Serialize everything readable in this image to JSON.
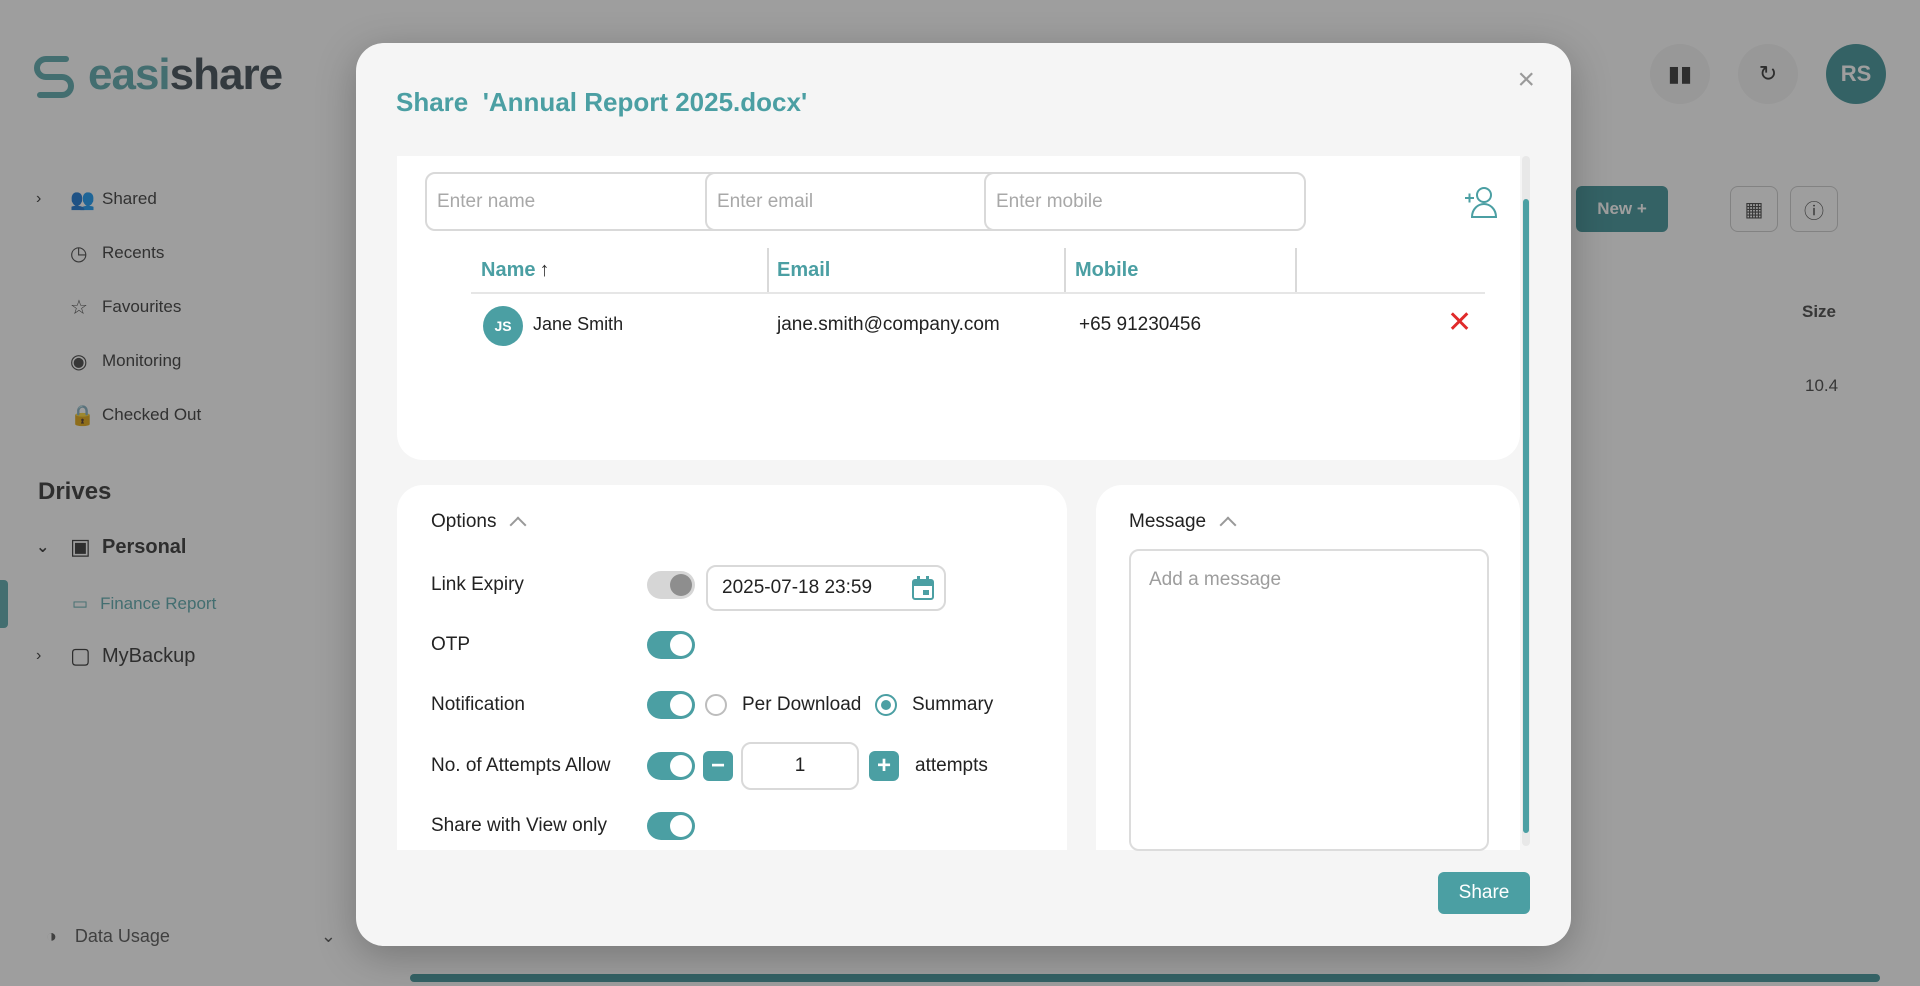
{
  "app": {
    "logo_prefix": "easi",
    "logo_suffix": "share",
    "avatar_initials": "RS",
    "sidebar": {
      "items": [
        {
          "label": "Shared",
          "icon": "people-icon"
        },
        {
          "label": "Recents",
          "icon": "clock-icon"
        },
        {
          "label": "Favourites",
          "icon": "star-icon"
        },
        {
          "label": "Monitoring",
          "icon": "monitor-icon"
        },
        {
          "label": "Checked Out",
          "icon": "lock-icon"
        }
      ],
      "drives_heading": "Drives",
      "personal": "Personal",
      "finance_report": "Finance Report",
      "mybackup": "MyBackup",
      "data_usage": "Data Usage"
    },
    "toolbar": {
      "new_label": "New +"
    },
    "table": {
      "size_header": "Size",
      "size_value": "10.4"
    }
  },
  "modal": {
    "title": "Share  'Annual Report 2025.docx'",
    "recipients": {
      "name_placeholder": "Enter name",
      "email_placeholder": "Enter email",
      "mobile_placeholder": "Enter mobile",
      "columns": {
        "name": "Name",
        "email": "Email",
        "mobile": "Mobile"
      },
      "sort_indicator": "↑",
      "rows": [
        {
          "initials": "JS",
          "first_name": "Jane",
          "last_name": "Smith",
          "email": "jane.smith@company.com",
          "mobile": "+65 91230456"
        }
      ]
    },
    "options": {
      "heading": "Options",
      "link_expiry": {
        "label": "Link Expiry",
        "enabled": false,
        "date": "2025-07-18 23:59"
      },
      "otp": {
        "label": "OTP",
        "enabled": true
      },
      "notification": {
        "label": "Notification",
        "enabled": true,
        "choices": [
          "Per Download",
          "Summary"
        ],
        "selected": "Summary"
      },
      "attempts": {
        "label": "No. of Attempts Allow",
        "enabled": true,
        "value": "1",
        "unit": "attempts"
      },
      "view_only": {
        "label": "Share with View only",
        "enabled": true
      }
    },
    "message": {
      "heading": "Message",
      "placeholder": "Add a message"
    },
    "share_label": "Share"
  },
  "colors": {
    "accent": "#4b9fa3",
    "danger": "#e02a2a",
    "logo_dark": "#3d4a52"
  }
}
